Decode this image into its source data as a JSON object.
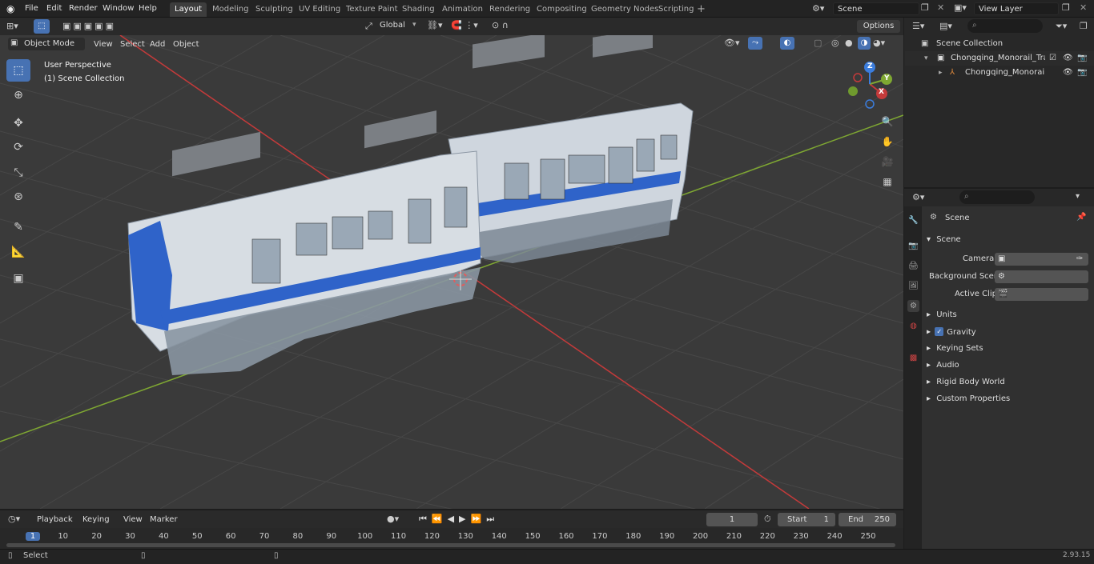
{
  "menus": [
    "File",
    "Edit",
    "Render",
    "Window",
    "Help"
  ],
  "workspaces": [
    "Layout",
    "Modeling",
    "Sculpting",
    "UV Editing",
    "Texture Paint",
    "Shading",
    "Animation",
    "Rendering",
    "Compositing",
    "Geometry Nodes",
    "Scripting"
  ],
  "active_workspace": "Layout",
  "scene_field": "Scene",
  "view_layer_field": "View Layer",
  "viewport": {
    "mode": "Object Mode",
    "menus": [
      "View",
      "Select",
      "Add",
      "Object"
    ],
    "orientation": "Global",
    "options_label": "Options",
    "overlay_title": "User Perspective",
    "overlay_subtitle": "(1) Scene Collection",
    "gizmo": {
      "x": "X",
      "y": "Y",
      "z": "Z"
    }
  },
  "outliner": {
    "root": "Scene Collection",
    "items": [
      "Chongqing_Monorail_Train_Hi",
      "Chongqing_Monorail_Tra"
    ]
  },
  "properties": {
    "header": "Scene",
    "section": "Scene",
    "camera_label": "Camera",
    "background_scene_label": "Background Scene",
    "active_clip_label": "Active Clip",
    "panels": [
      "Units",
      "Gravity",
      "Keying Sets",
      "Audio",
      "Rigid Body World",
      "Custom Properties"
    ]
  },
  "timeline": {
    "menus": [
      "Playback",
      "Keying",
      "View",
      "Marker"
    ],
    "current_frame": "1",
    "start_label": "Start",
    "start": "1",
    "end_label": "End",
    "end": "250",
    "ticks": [
      "1",
      "10",
      "20",
      "30",
      "40",
      "50",
      "60",
      "70",
      "80",
      "90",
      "100",
      "110",
      "120",
      "130",
      "140",
      "150",
      "160",
      "170",
      "180",
      "190",
      "200",
      "210",
      "220",
      "230",
      "240",
      "250"
    ]
  },
  "status": {
    "left": "Select",
    "version": "2.93.15"
  },
  "colors": {
    "accent": "#4772b3",
    "x_axis": "#c43a3a",
    "y_axis": "#7fa832",
    "z_axis": "#3b7ddd"
  }
}
